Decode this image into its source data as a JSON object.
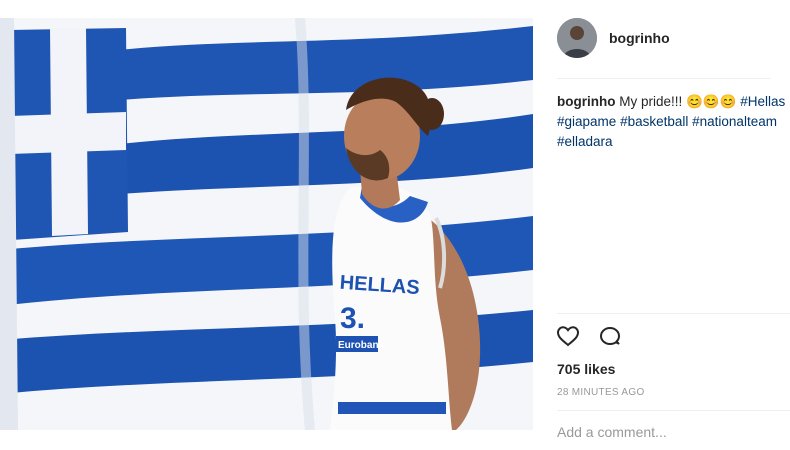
{
  "post": {
    "username": "bogrinho",
    "caption": {
      "username": "bogrinho",
      "text": "My pride!!! 😊😊😊",
      "hashtags": [
        "#Hellas",
        "#giapame",
        "#basketball",
        "#nationalteam",
        "#elladara"
      ]
    },
    "likes": "705 likes",
    "timestamp": "28 MINUTES AGO",
    "comment_placeholder": "Add a comment..."
  },
  "photo": {
    "jersey_text": "HELLAS",
    "jersey_number": "3.",
    "jersey_sponsor": "Eurobank"
  },
  "icons": {
    "like": "heart-icon",
    "comment": "comment-icon"
  },
  "colors": {
    "flag_blue": "#1d56b5",
    "text_primary": "#262626",
    "text_secondary": "#999999",
    "hashtag": "#003569"
  }
}
